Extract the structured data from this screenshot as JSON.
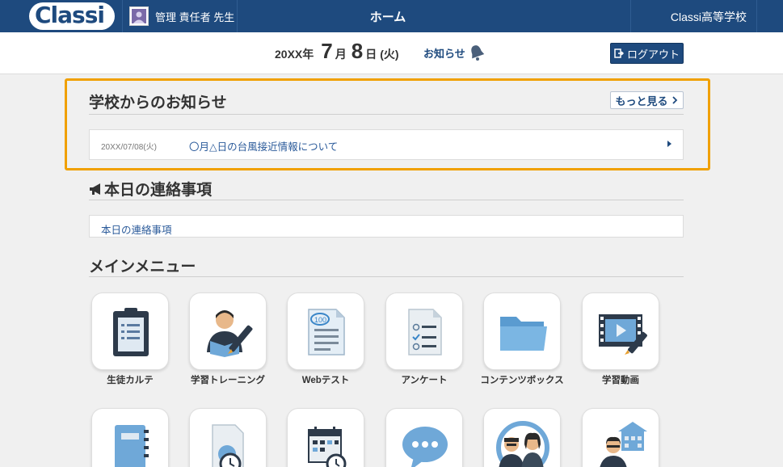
{
  "header": {
    "logo": "Classi",
    "user_name": "管理 責任者 先生",
    "page_title": "ホーム",
    "school_name": "Classi高等学校"
  },
  "subheader": {
    "date_year": "20XX年",
    "date_month": "7",
    "date_month_unit": "月",
    "date_day": "8",
    "date_day_unit": "日",
    "date_weekday": "(火)",
    "news_label": "お知らせ",
    "logout_label": "ログアウト"
  },
  "school_notices": {
    "title": "学校からのお知らせ",
    "more_label": "もっと見る",
    "items": [
      {
        "date": "20XX/07/08(火)",
        "text": "〇月△日の台風接近情報について"
      }
    ]
  },
  "daily_contact": {
    "title": "本日の連絡事項",
    "content": "本日の連絡事項"
  },
  "main_menu": {
    "title": "メインメニュー",
    "items": [
      {
        "label": "生徒カルテ",
        "icon": "clipboard-icon"
      },
      {
        "label": "学習トレーニング",
        "icon": "student-study-icon"
      },
      {
        "label": "Webテスト",
        "icon": "web-test-icon"
      },
      {
        "label": "アンケート",
        "icon": "survey-icon"
      },
      {
        "label": "コンテンツボックス",
        "icon": "folder-icon"
      },
      {
        "label": "学習動画",
        "icon": "video-icon"
      },
      {
        "label": "",
        "icon": "notebook-icon"
      },
      {
        "label": "",
        "icon": "document-clock-icon"
      },
      {
        "label": "",
        "icon": "calendar-clock-icon"
      },
      {
        "label": "",
        "icon": "chat-bubble-icon"
      },
      {
        "label": "",
        "icon": "group-icon"
      },
      {
        "label": "",
        "icon": "teacher-school-icon"
      }
    ]
  },
  "colors": {
    "header_bg": "#1e4a7e",
    "highlight_border": "#f0a000",
    "link_text": "#2a5a9a"
  }
}
